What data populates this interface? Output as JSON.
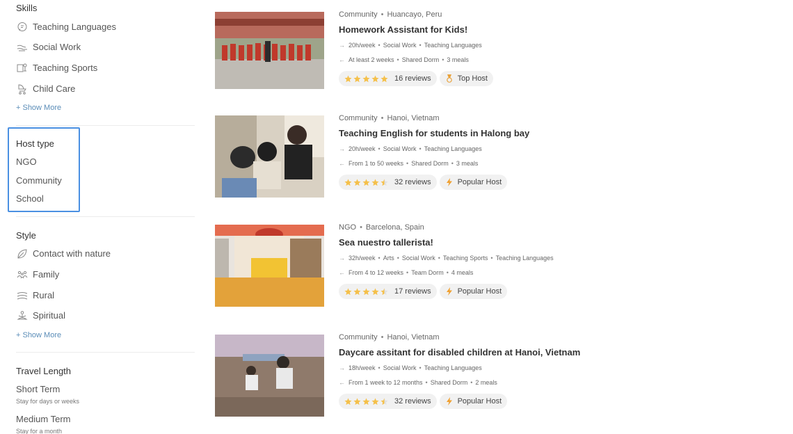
{
  "filters": {
    "skills": {
      "title": "Skills",
      "items": [
        {
          "label": "Teaching Languages",
          "icon": "speech-bubble-icon"
        },
        {
          "label": "Social Work",
          "icon": "hands-icon"
        },
        {
          "label": "Teaching Sports",
          "icon": "sports-icon"
        },
        {
          "label": "Child Care",
          "icon": "stroller-icon"
        }
      ],
      "show_more": "+ Show More"
    },
    "host_type": {
      "title": "Host type",
      "items": [
        "NGO",
        "Community",
        "School"
      ]
    },
    "style": {
      "title": "Style",
      "items": [
        {
          "label": "Contact with nature",
          "icon": "leaf-icon"
        },
        {
          "label": "Family",
          "icon": "family-icon"
        },
        {
          "label": "Rural",
          "icon": "fields-icon"
        },
        {
          "label": "Spiritual",
          "icon": "meditation-icon"
        }
      ],
      "show_more": "+ Show More"
    },
    "travel_length": {
      "title": "Travel Length",
      "items": [
        {
          "label": "Short Term",
          "sub": "Stay for days or weeks"
        },
        {
          "label": "Medium Term",
          "sub": "Stay for a month"
        }
      ]
    }
  },
  "listings": [
    {
      "type": "Community",
      "location": "Huancayo, Peru",
      "title": "Homework Assistant for Kids!",
      "hours": "20h/week",
      "tags": [
        "Social Work",
        "Teaching Languages"
      ],
      "duration": "At least 2 weeks",
      "accommodation": "Shared Dorm",
      "meals": "3 meals",
      "rating": 5,
      "reviews": "16 reviews",
      "badge": "Top Host",
      "badge_icon": "medal-icon"
    },
    {
      "type": "Community",
      "location": "Hanoi, Vietnam",
      "title": "Teaching English for students in Halong bay",
      "hours": "20h/week",
      "tags": [
        "Social Work",
        "Teaching Languages"
      ],
      "duration": "From 1 to 50 weeks",
      "accommodation": "Shared Dorm",
      "meals": "3 meals",
      "rating": 4.5,
      "reviews": "32 reviews",
      "badge": "Popular Host",
      "badge_icon": "lightning-icon"
    },
    {
      "type": "NGO",
      "location": "Barcelona, Spain",
      "title": "Sea nuestro tallerista!",
      "hours": "32h/week",
      "tags": [
        "Arts",
        "Social Work",
        "Teaching Sports",
        "Teaching Languages"
      ],
      "duration": "From 4 to 12 weeks",
      "accommodation": "Team Dorm",
      "meals": "4 meals",
      "rating": 4.5,
      "reviews": "17 reviews",
      "badge": "Popular Host",
      "badge_icon": "lightning-icon"
    },
    {
      "type": "Community",
      "location": "Hanoi, Vietnam",
      "title": "Daycare assitant for disabled children at Hanoi, Vietnam",
      "hours": "18h/week",
      "tags": [
        "Social Work",
        "Teaching Languages"
      ],
      "duration": "From 1 week to 12 months",
      "accommodation": "Shared Dorm",
      "meals": "2 meals",
      "rating": 4.5,
      "reviews": "32 reviews",
      "badge": "Popular Host",
      "badge_icon": "lightning-icon"
    }
  ],
  "colors": {
    "star": "#f5c04a",
    "highlight": "#4a90e2",
    "link": "#5b8db8",
    "pill_bg": "#f1f1f1"
  }
}
